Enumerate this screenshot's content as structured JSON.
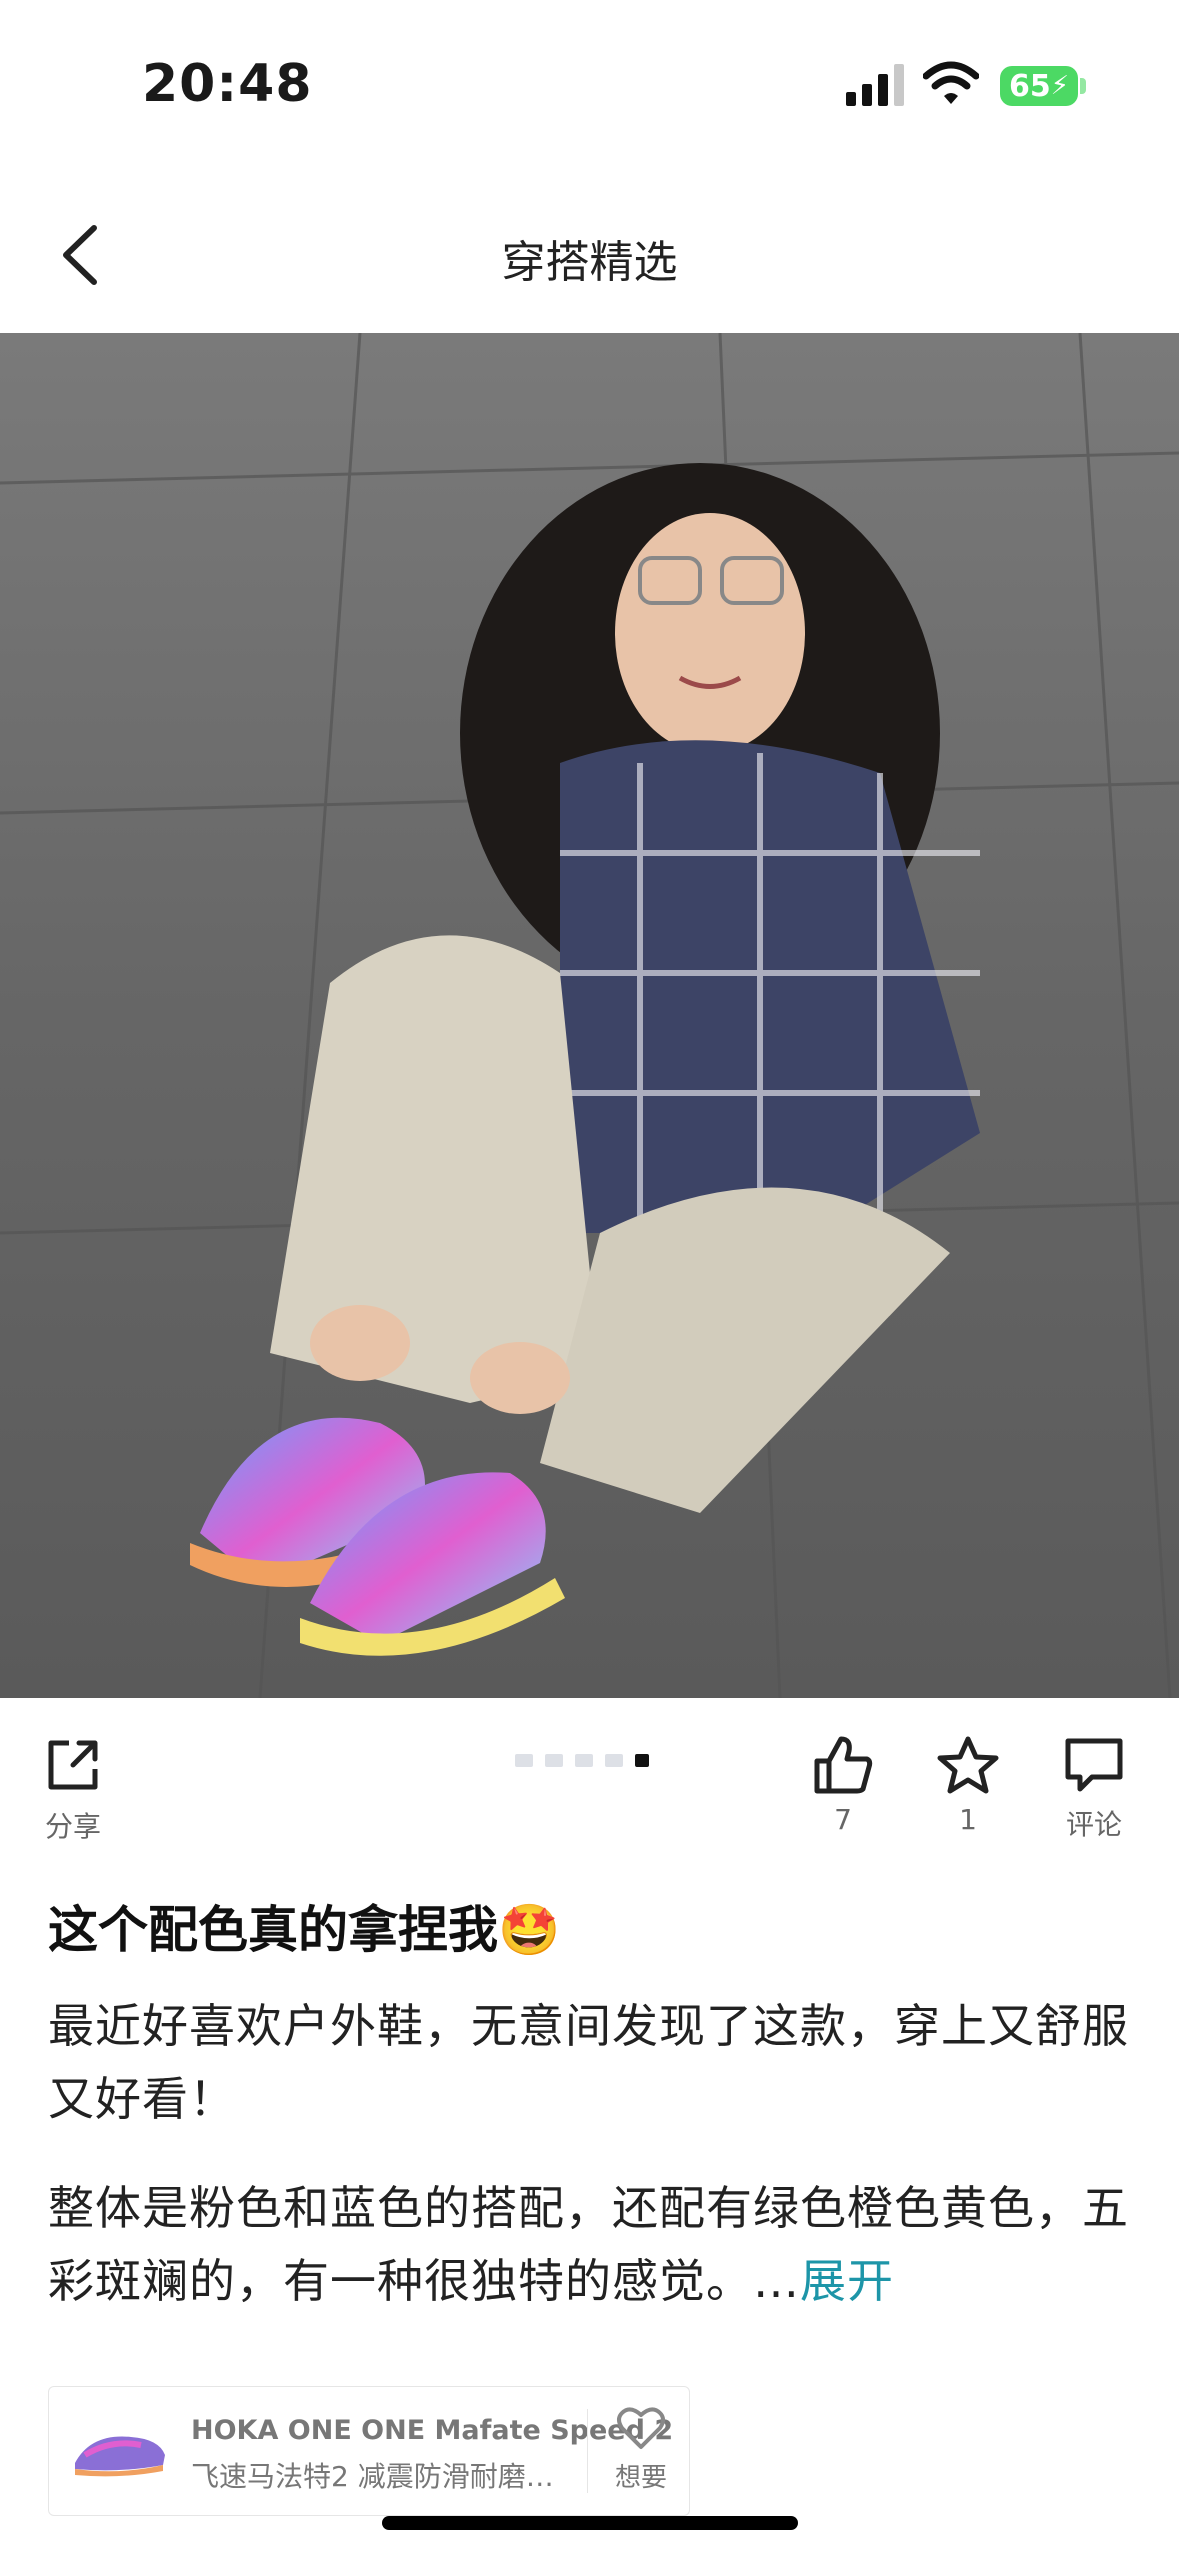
{
  "status_bar": {
    "time": "20:48",
    "battery": "65"
  },
  "nav": {
    "title": "穿搭精选"
  },
  "actions": {
    "share_label": "分享",
    "like_count": "7",
    "favorite_count": "1",
    "comment_label": "评论"
  },
  "gallery": {
    "total": 5,
    "active_index": 4
  },
  "post": {
    "title": "这个配色真的拿捏我🤩",
    "paragraph1": "最近好喜欢户外鞋，无意间发现了这款，穿上又舒服又好看！",
    "paragraph2": "整体是粉色和蓝色的搭配，还配有绿色橙色黄色，五彩斑斓的，有一种很独特的感觉。…",
    "expand_label": "展开"
  },
  "product": {
    "name": "HOKA ONE ONE Mafate Speed 2",
    "desc": "飞速马法特2 减震防滑耐磨…",
    "want_label": "想要"
  },
  "colors": {
    "accent": "#1d95a8",
    "battery": "#4cd964"
  },
  "icons": [
    "back-icon",
    "share-icon",
    "like-icon",
    "star-icon",
    "comment-icon",
    "heart-icon",
    "cell-signal-icon",
    "wifi-icon"
  ]
}
